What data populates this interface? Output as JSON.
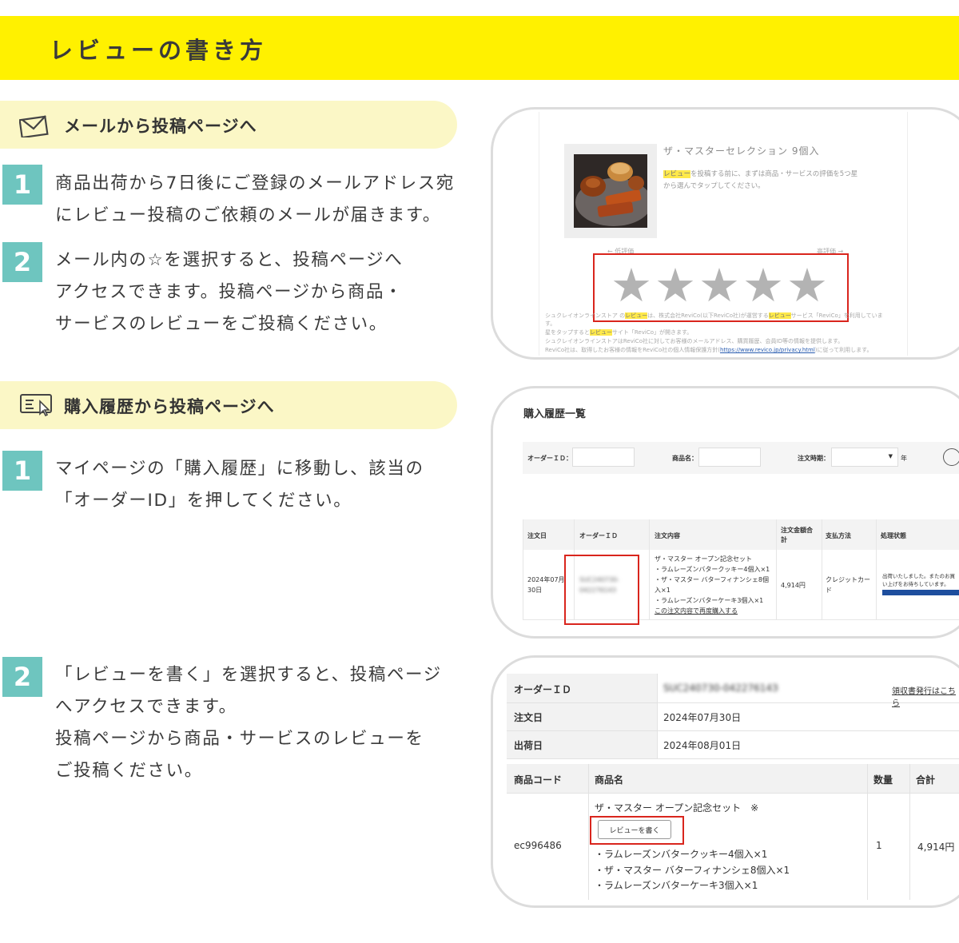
{
  "header": {
    "title": "レビューの書き方"
  },
  "section_mail": {
    "title": "メールから投稿ページへ",
    "steps": [
      {
        "num": "1",
        "lines": [
          "商品出荷から7日後にご登録のメールアドレス宛",
          "にレビュー投稿のご依頼のメールが届きます。"
        ]
      },
      {
        "num": "2",
        "lines": [
          "メール内の☆を選択すると、投稿ページへ",
          "アクセスできます。投稿ページから商品・",
          "サービスのレビューをご投稿ください。"
        ]
      }
    ]
  },
  "section_history": {
    "title": "購入履歴から投稿ページへ",
    "steps": [
      {
        "num": "1",
        "lines": [
          "マイページの「購入履歴」に移動し、該当の",
          "「オーダーID」を押してください。"
        ]
      },
      {
        "num": "2",
        "lines": [
          "「レビューを書く」を選択すると、投稿ページ",
          "へアクセスできます。",
          "投稿ページから商品・サービスのレビューを",
          "ご投稿ください。"
        ]
      }
    ]
  },
  "mail_screen": {
    "product_title": "ザ・マスターセレクション 9個入",
    "desc_highlight": "レビュー",
    "desc_line1": "を投稿する前に、まずは商品・サービスの評価を5つ星",
    "desc_line2": "から選んでタップしてください。",
    "low_label": "← 低評価",
    "high_label": "高評価 →",
    "stars": [
      "★",
      "★",
      "★",
      "★",
      "★"
    ],
    "fine1_a": "シュクレイオンラインストア の",
    "fine1_hl1": "レビュー",
    "fine1_b": "は、株式会社ReviCo(以下ReviCo社)が運営する",
    "fine1_hl2": "レビュー",
    "fine1_c": "サービス「ReviCo」を利用していま",
    "fine2": "す。",
    "fine3_a": "星をタップすると",
    "fine3_hl": "レビュー",
    "fine3_b": "サイト「ReviCo」が開きます。",
    "fine4": "シュクレイオンラインストアはReviCo社に対してお客様のメールアドレス、購買履歴、会員ID等の情報を提供します。",
    "fine5_a": "ReviCo社は、取得したお客様の情報をReviCo社の個人情報保護方針(",
    "fine5_link": "https://www.revico.jp/privacy.html",
    "fine5_b": ")に従って利用します。"
  },
  "history_screen": {
    "title": "購入履歴一覧",
    "filter_order_label": "オーダーＩＤ：",
    "filter_product_label": "商品名：",
    "filter_period_label": "注文時期：",
    "filter_select_arrow": "▼",
    "filter_year": "年",
    "headers": [
      "注文日",
      "オーダーＩＤ",
      "注文内容",
      "注文金額合計",
      "支払方法",
      "処理状態"
    ],
    "row": {
      "date": "2024年07月30日",
      "order_id_line1": "SUC240730-",
      "order_id_line2": "04227614З",
      "items": [
        "ザ・マスター オープン記念セット",
        "・ラムレーズンバタークッキー4個入×1",
        "・ザ・マスター バターフィナンシェ8個入×1",
        "・ラムレーズンバターケーキ3個入×1"
      ],
      "reorder_link": "この注文内容で再度購入する",
      "amount": "4,914円",
      "payment": "クレジットカード",
      "status": "出荷いたしました。またのお買い上げをお待ちしています。"
    }
  },
  "order_detail_screen": {
    "order_id_label": "オーダーＩＤ",
    "order_id_value": "SUC240730-04227614З",
    "receipt_link": "領収書発行はこちら",
    "order_date_label": "注文日",
    "order_date_value": "2024年07月30日",
    "ship_date_label": "出荷日",
    "ship_date_value": "2024年08月01日",
    "headers": [
      "商品コード",
      "商品名",
      "数量",
      "合計"
    ],
    "item": {
      "code": "ec996486",
      "name": "ザ・マスター オープン記念セット　※",
      "review_button": "レビューを書く",
      "sub_items": [
        "・ラムレーズンバタークッキー4個入×1",
        "・ザ・マスター バターフィナンシェ8個入×1",
        "・ラムレーズンバターケーキ3個入×1"
      ],
      "qty": "1",
      "total": "4,914円"
    }
  },
  "colors": {
    "header": "#fff100",
    "pill": "#fbf7c6",
    "step": "#6ec5bf",
    "highlight_box": "#d9251d"
  },
  "icons": {
    "mail": "mail-icon",
    "history": "purchase-history-icon"
  }
}
